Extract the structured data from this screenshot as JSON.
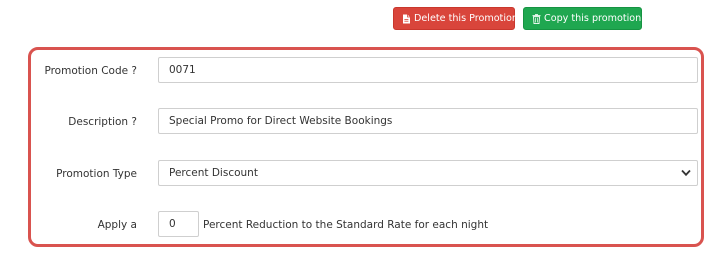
{
  "actions": {
    "delete_label": "Delete this Promotion",
    "copy_label": "Copy this promotion"
  },
  "form": {
    "promotion_code": {
      "label": "Promotion Code ?",
      "value": "0071"
    },
    "description": {
      "label": "Description ?",
      "value": "Special Promo for Direct Website Bookings"
    },
    "promotion_type": {
      "label": "Promotion Type",
      "selected": "Percent Discount"
    },
    "apply": {
      "label": "Apply a",
      "value": "0",
      "suffix": "Percent Reduction to the Standard Rate for each night"
    }
  },
  "colors": {
    "danger": "#d9453b",
    "success": "#1fa750",
    "panel_border": "#d9534f"
  },
  "icons": {
    "delete": "file-icon",
    "copy": "trash-icon",
    "select": "chevron-down-icon"
  }
}
